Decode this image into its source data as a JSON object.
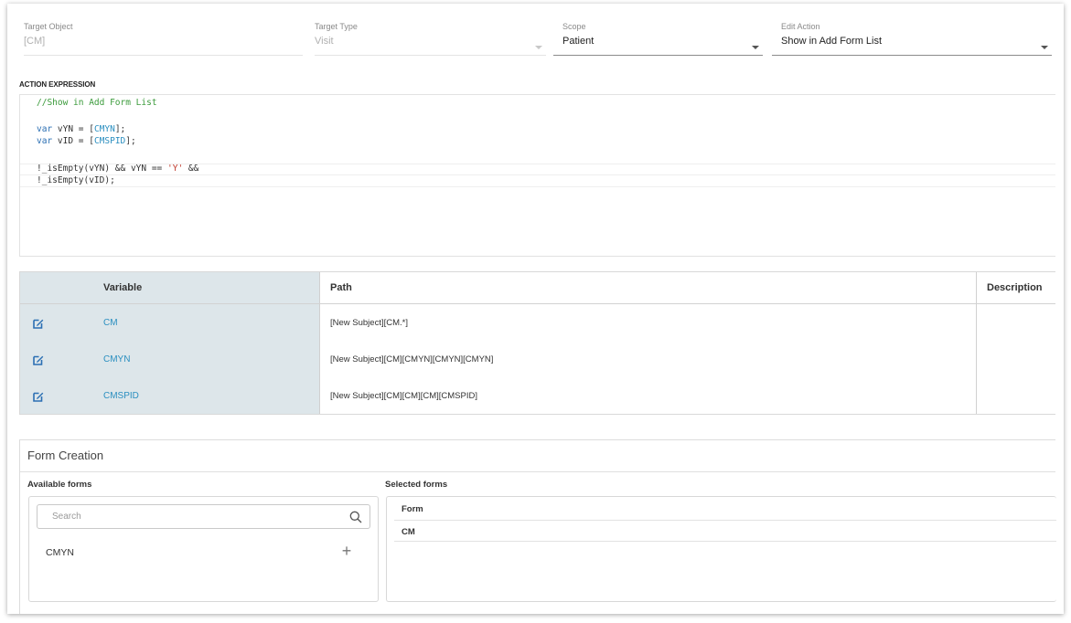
{
  "fields": {
    "target_object": {
      "label": "Target Object",
      "value": "[CM]"
    },
    "target_type": {
      "label": "Target Type",
      "value": "Visit"
    },
    "scope": {
      "label": "Scope",
      "value": "Patient"
    },
    "edit_action": {
      "label": "Edit Action",
      "value": "Show in Add Form List"
    }
  },
  "expression": {
    "label": "ACTION EXPRESSION",
    "comment": "//Show in Add Form List",
    "line2_kw": "var",
    "line2_name": " vYN = [",
    "line2_id": "CMYN",
    "line2_end": "];",
    "line3_kw": "var",
    "line3_name": " vID = [",
    "line3_id": "CMSPID",
    "line3_end": "];",
    "line5_a": "!_isEmpty(vYN) && vYN == ",
    "line5_str": "'Y'",
    "line5_b": " &&",
    "line6": "!_isEmpty(vID);"
  },
  "variables": {
    "headers": {
      "variable": "Variable",
      "path": "Path",
      "description": "Description"
    },
    "rows": [
      {
        "name": "CM",
        "path": "[New Subject][CM.*]"
      },
      {
        "name": "CMYN",
        "path": "[New Subject][CM][CMYN][CMYN][CMYN]"
      },
      {
        "name": "CMSPID",
        "path": "[New Subject][CM][CM][CM][CMSPID]"
      }
    ]
  },
  "form_creation": {
    "title": "Form Creation",
    "available_label": "Available forms",
    "selected_label": "Selected forms",
    "search_placeholder": "Search",
    "available_items": [
      "CMYN"
    ],
    "selected_header": "Form",
    "selected_items": [
      "CM"
    ]
  },
  "colors": {
    "accent_link": "#2b8fc0",
    "variable_column_bg": "#dde6ea",
    "comment_green": "#3a9a3a"
  },
  "icons": {
    "edit": "edit-icon",
    "search": "search-icon",
    "add": "plus-icon",
    "dropdown": "chevron-down-icon"
  }
}
